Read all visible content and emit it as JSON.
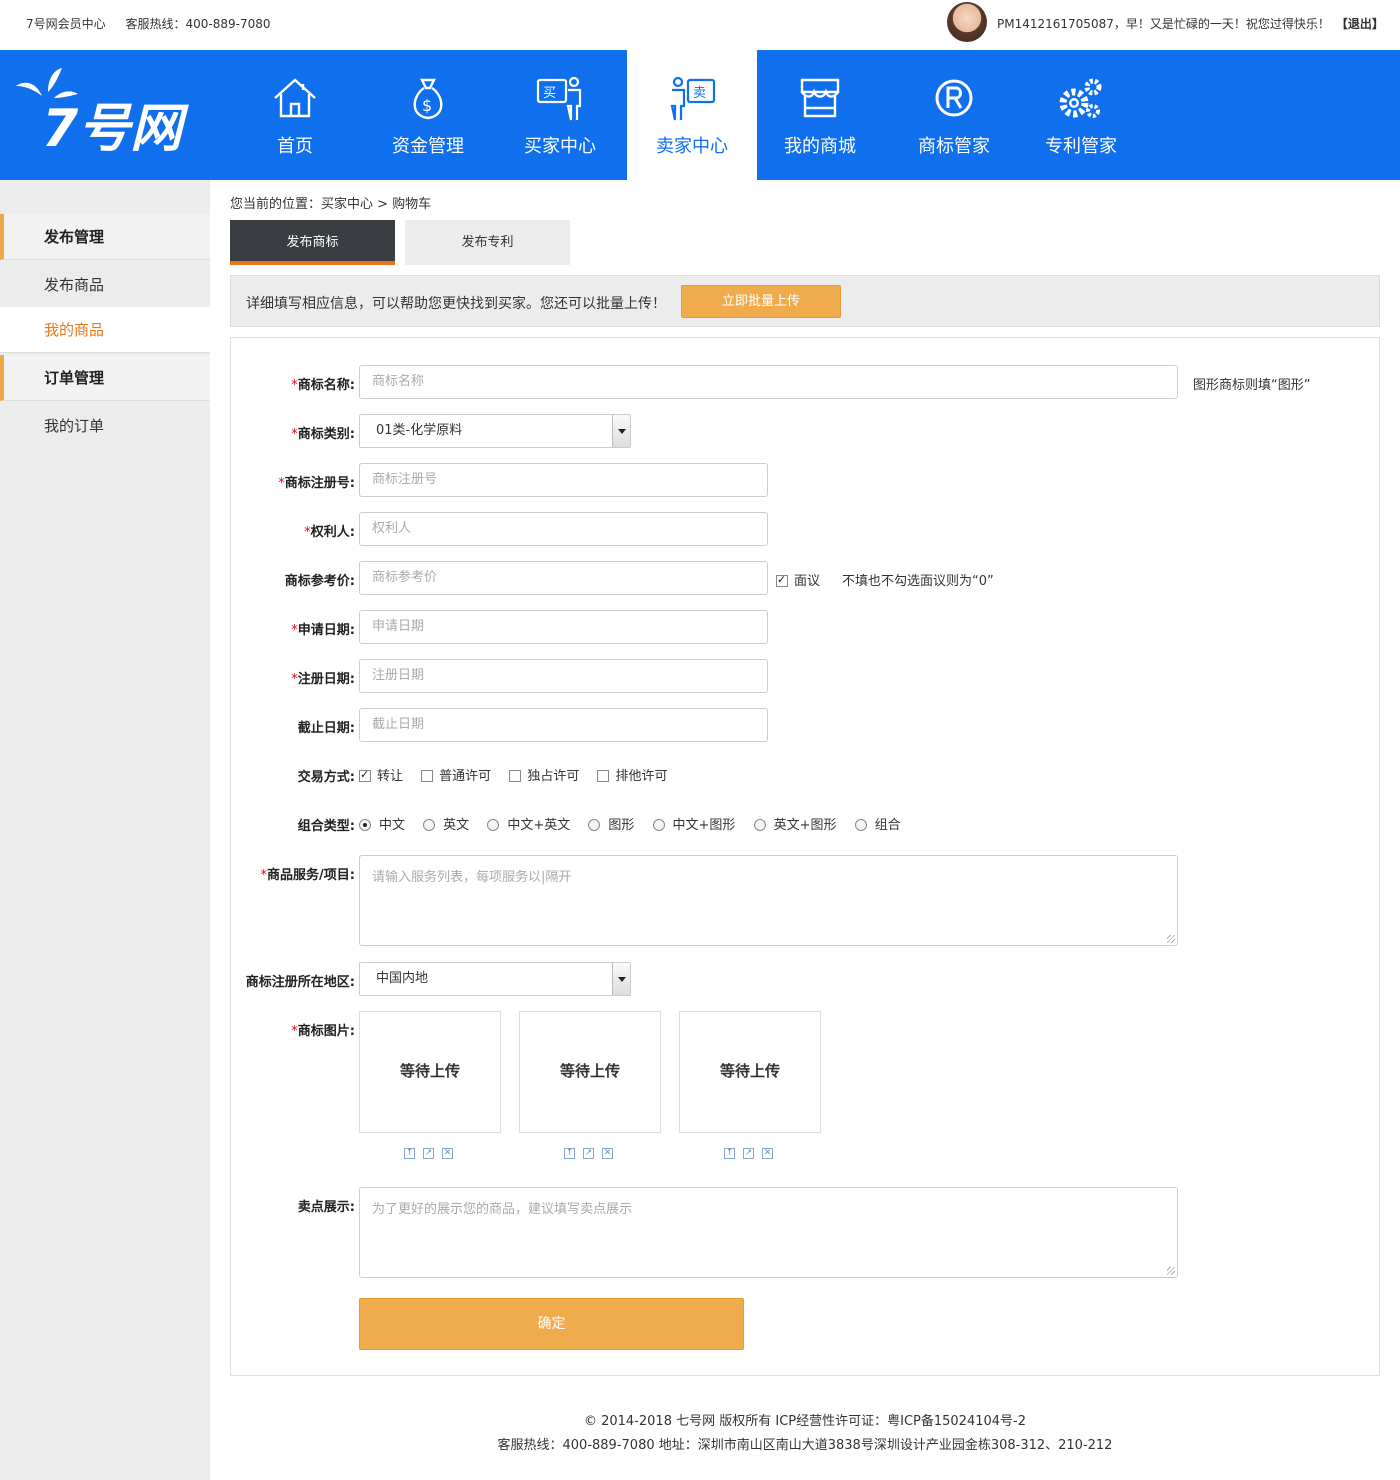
{
  "topbar": {
    "site": "7号网会员中心",
    "hotline": "客服热线：400-889-7080",
    "greeting": "PM1412161705087，早！又是忙碌的一天！祝您过得快乐！",
    "logout": "【退出】"
  },
  "logo": {
    "text": "7号网"
  },
  "nav": [
    {
      "label": "首页",
      "icon": "home-icon"
    },
    {
      "label": "资金管理",
      "icon": "money-bag-icon"
    },
    {
      "label": "买家中心",
      "icon": "buyer-icon"
    },
    {
      "label": "卖家中心",
      "icon": "seller-icon",
      "active": true
    },
    {
      "label": "我的商城",
      "icon": "store-icon"
    },
    {
      "label": "商标管家",
      "icon": "registered-icon"
    },
    {
      "label": "专利管家",
      "icon": "gears-icon"
    }
  ],
  "sidebar": {
    "group1": "发布管理",
    "item1": "发布商品",
    "item2": "我的商品",
    "group2": "订单管理",
    "item3": "我的订单"
  },
  "breadcrumb": "您当前的位置：买家中心 >  购物车",
  "tabs": [
    "发布商标",
    "发布专利"
  ],
  "notice": {
    "text": "详细填写相应信息，可以帮助您更快找到买家。您还可以批量上传！",
    "button": "立即批量上传"
  },
  "form": {
    "name_label": "商标名称:",
    "name_placeholder": "商标名称",
    "name_hint": "图形商标则填“图形”",
    "category_label": "商标类别:",
    "category_value": "01类-化学原料",
    "regno_label": "商标注册号:",
    "regno_placeholder": "商标注册号",
    "owner_label": "权利人:",
    "owner_placeholder": "权利人",
    "price_label": "商标参考价:",
    "price_placeholder": "商标参考价",
    "negotiable": "面议",
    "price_hint": "不填也不勾选面议则为“0”",
    "applydate_label": "申请日期:",
    "applydate_placeholder": "申请日期",
    "regdate_label": "注册日期:",
    "regdate_placeholder": "注册日期",
    "enddate_label": "截止日期:",
    "enddate_placeholder": "截止日期",
    "trade_label": "交易方式:",
    "trade_options": [
      "转让",
      "普通许可",
      "独占许可",
      "排他许可"
    ],
    "combo_label": "组合类型:",
    "combo_options": [
      "中文",
      "英文",
      "中文+英文",
      "图形",
      "中文+图形",
      "英文+图形",
      "组合"
    ],
    "service_label": "商品服务/项目:",
    "service_placeholder": "请输入服务列表，每项服务以|隔开",
    "region_label": "商标注册所在地区:",
    "region_value": "中国内地",
    "image_label": "商标图片:",
    "upload_text": "等待上传",
    "selling_label": "卖点展示:",
    "selling_placeholder": "为了更好的展示您的商品，建议填写卖点展示",
    "submit": "确定"
  },
  "footer": {
    "line1": "© 2014-2018 七号网 版权所有 ICP经营性许可证：粤ICP备15024104号-2",
    "line2": "客服热线：400-889-7080   地址：深圳市南山区南山大道3838号深圳设计产业园金栋308-312、210-212"
  },
  "colors": {
    "header_blue": "#0f6fed",
    "accent_orange": "#f0ab4c",
    "active_orange": "#e7791a"
  }
}
